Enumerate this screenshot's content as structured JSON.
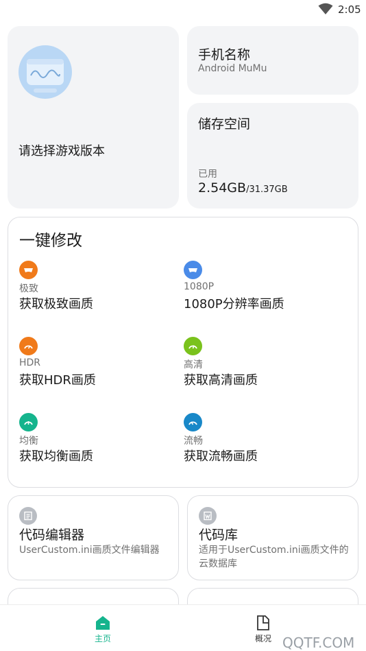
{
  "status_bar": {
    "time": "2:05"
  },
  "game_card": {
    "label": "请选择游戏版本"
  },
  "phone_card": {
    "title": "手机名称",
    "value": "Android MuMu"
  },
  "storage_card": {
    "title": "储存空间",
    "used_label": "已用",
    "used": "2.54GB",
    "total": "/31.37GB"
  },
  "modify": {
    "title": "一键修改",
    "presets": [
      {
        "tag": "极致",
        "label": "获取极致画质",
        "icon": "ultra-icon",
        "color": "#f07a1a"
      },
      {
        "tag": "1080P",
        "label": "1080P分辨率画质",
        "icon": "resolution-icon",
        "color": "#4a8be8"
      },
      {
        "tag": "HDR",
        "label": "获取HDR画质",
        "icon": "hdr-gauge-icon",
        "color": "#f07a1a"
      },
      {
        "tag": "高清",
        "label": "获取高清画质",
        "icon": "hd-gauge-icon",
        "color": "#7ac21c"
      },
      {
        "tag": "均衡",
        "label": "获取均衡画质",
        "icon": "balanced-gauge-icon",
        "color": "#15b48d"
      },
      {
        "tag": "流畅",
        "label": "获取流畅画质",
        "icon": "smooth-gauge-icon",
        "color": "#1988c8"
      }
    ]
  },
  "tools": [
    {
      "title": "代码编辑器",
      "desc": "UserCustom.ini画质文件编辑器",
      "icon": "editor-icon"
    },
    {
      "title": "代码库",
      "desc": "适用于UserCustom.ini画质文件的云数据库",
      "icon": "library-icon"
    }
  ],
  "nav": [
    {
      "label": "主页",
      "icon": "home-icon",
      "active": true,
      "color": "#15b48d"
    },
    {
      "label": "概况",
      "icon": "overview-icon",
      "active": false,
      "color": "#333333"
    }
  ],
  "watermark": "QQTF.COM"
}
